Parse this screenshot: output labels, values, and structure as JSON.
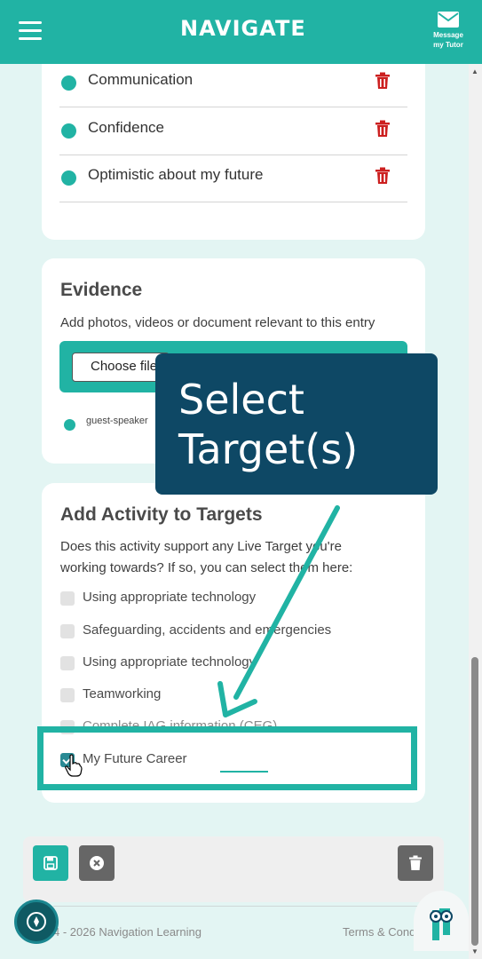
{
  "header": {
    "logo": "NAVIGATE",
    "message_label_1": "Message",
    "message_label_2": "my Tutor"
  },
  "qualities": [
    {
      "label": "Communication"
    },
    {
      "label": "Confidence"
    },
    {
      "label": "Optimistic about my future"
    }
  ],
  "evidence": {
    "title": "Evidence",
    "subtitle": "Add photos, videos or document relevant to this entry",
    "choose_label": "Choose file",
    "file_name": "guest-speaker"
  },
  "targets": {
    "title": "Add Activity to Targets",
    "question_line1": "Does this activity support any Live Target you're",
    "question_line2": "working towards? If so, you can select them here:",
    "items": [
      {
        "label": "Using appropriate technology",
        "checked": false
      },
      {
        "label": "Safeguarding, accidents and emergencies",
        "checked": false
      },
      {
        "label": "Using appropriate technology",
        "checked": false
      },
      {
        "label": "Teamworking",
        "checked": false
      },
      {
        "label": "Complete IAG information (CEG)",
        "checked": false
      },
      {
        "label": "My Future Career",
        "checked": true
      }
    ]
  },
  "footer": {
    "copyright": "4 - 2026 Navigation Learning",
    "terms": "Terms & Conditions"
  },
  "tooltip": {
    "text": "Select\nTarget(s)"
  },
  "colors": {
    "teal": "#21b3a4",
    "navy": "#0e4865",
    "delete_red": "#cc1f1f"
  },
  "icons": [
    "hamburger-icon",
    "envelope-icon",
    "trash-icon",
    "save-icon",
    "close-icon",
    "compass-icon",
    "helper-icon"
  ]
}
